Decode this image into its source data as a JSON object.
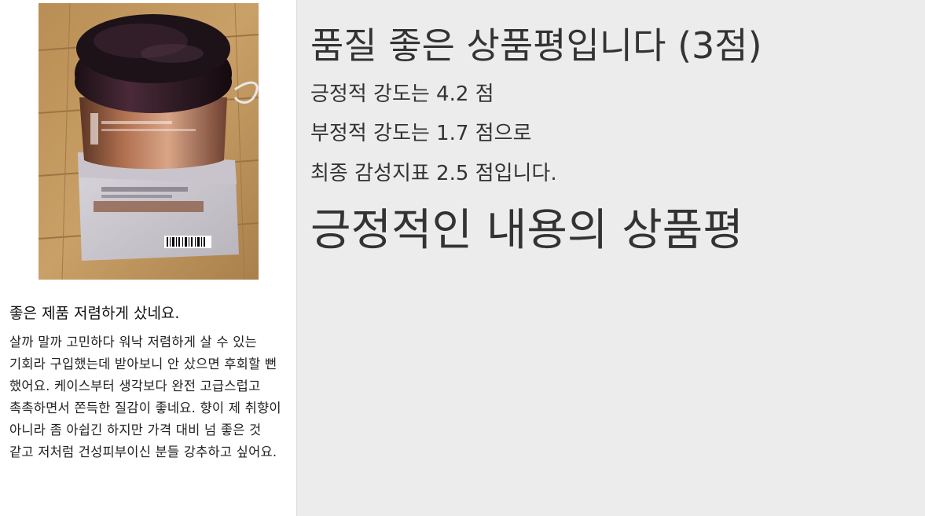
{
  "sidebar": {
    "image_alt": "product photo",
    "review": {
      "title": "좋은 제품 저렴하게 샀네요.",
      "body": "살까 말까 고민하다 워낙 저렴하게 살 수 있는 기회라 구입했는데 받아보니 안 샀으면 후회할 뻔 했어요. 케이스부터 생각보다 완전 고급스럽고 촉촉하면서 쫀득한 질감이 좋네요. 향이 제 취향이 아니라 좀 아쉽긴 하지만 가격 대비 넘 좋은 것 같고 저처럼 건성피부이신 분들 강추하고 싶어요."
    }
  },
  "main": {
    "headline": "품질 좋은 상품평입니다 (3점)",
    "positive_intensity": "긍정적 강도는 4.2 점",
    "negative_intensity": "부정적 강도는 1.7 점으로",
    "final_index": "최종 감성지표 2.5 점입니다.",
    "section_heading": "긍정적인 내용의 상품평"
  },
  "colors": {
    "background": "#ececec",
    "sidebar": "#ffffff",
    "text": "#333333"
  }
}
